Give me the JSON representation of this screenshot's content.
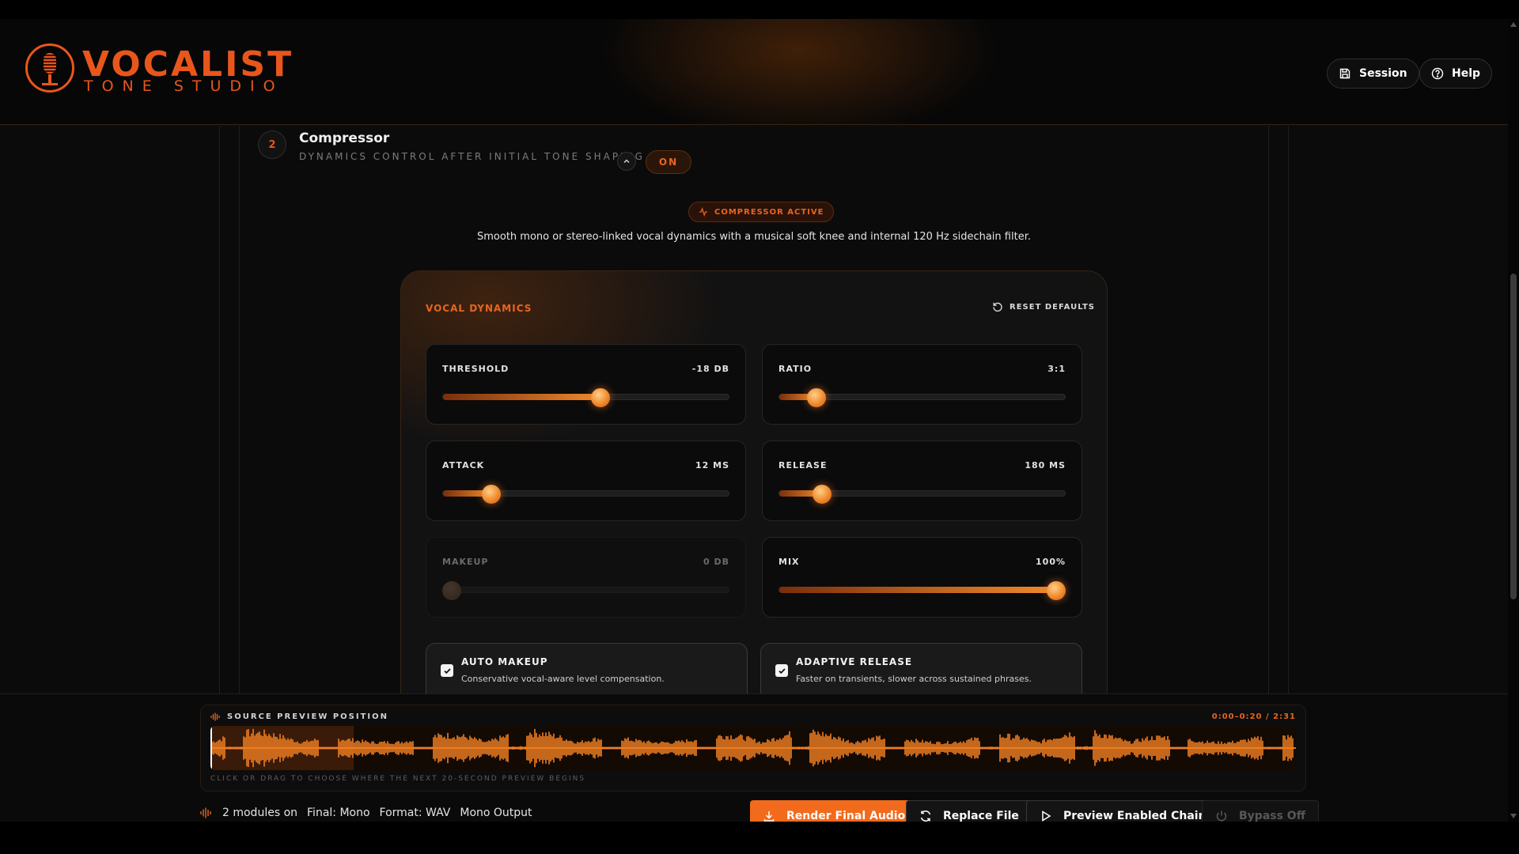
{
  "brand": {
    "title": "VOCALIST",
    "subtitle": "TONE STUDIO"
  },
  "header": {
    "session_label": "Session",
    "help_label": "Help"
  },
  "module": {
    "number": "2",
    "title": "Compressor",
    "subtitle": "DYNAMICS CONTROL AFTER INITIAL TONE SHAPING",
    "toggle_label": "ON",
    "badge": "COMPRESSOR ACTIVE",
    "description": "Smooth mono or stereo-linked vocal dynamics with a musical soft knee and internal 120 Hz sidechain filter."
  },
  "panel": {
    "title": "VOCAL DYNAMICS",
    "reset_label": "RESET DEFAULTS",
    "sliders": [
      {
        "label": "THRESHOLD",
        "value": "-18 DB",
        "fraction": 0.55,
        "disabled": false
      },
      {
        "label": "RATIO",
        "value": "3:1",
        "fraction": 0.13,
        "disabled": false
      },
      {
        "label": "ATTACK",
        "value": "12 MS",
        "fraction": 0.17,
        "disabled": false
      },
      {
        "label": "RELEASE",
        "value": "180 MS",
        "fraction": 0.15,
        "disabled": false
      },
      {
        "label": "MAKEUP",
        "value": "0 DB",
        "fraction": 0.03,
        "disabled": true
      },
      {
        "label": "MIX",
        "value": "100%",
        "fraction": 0.97,
        "disabled": false
      }
    ],
    "checks": [
      {
        "title": "AUTO MAKEUP",
        "description": "Conservative vocal-aware level compensation.",
        "checked": true
      },
      {
        "title": "ADAPTIVE RELEASE",
        "description": "Faster on transients, slower across sustained phrases.",
        "checked": true
      }
    ]
  },
  "preview": {
    "title": "SOURCE PREVIEW POSITION",
    "time": "0:00–0:20 / 2:31",
    "hint": "CLICK OR DRAG TO CHOOSE WHERE THE NEXT 20-SECOND PREVIEW BEGINS",
    "window_fraction": 0.132
  },
  "status": {
    "modules": "2 modules on",
    "final": "Final: Mono",
    "format": "Format: WAV",
    "output": "Mono Output"
  },
  "actions": {
    "render": "Render Final Audio",
    "replace": "Replace File",
    "preview": "Preview Enabled Chain",
    "bypass": "Bypass Off"
  },
  "colors": {
    "accent": "#f26a1b",
    "background": "#0b0b0b"
  }
}
